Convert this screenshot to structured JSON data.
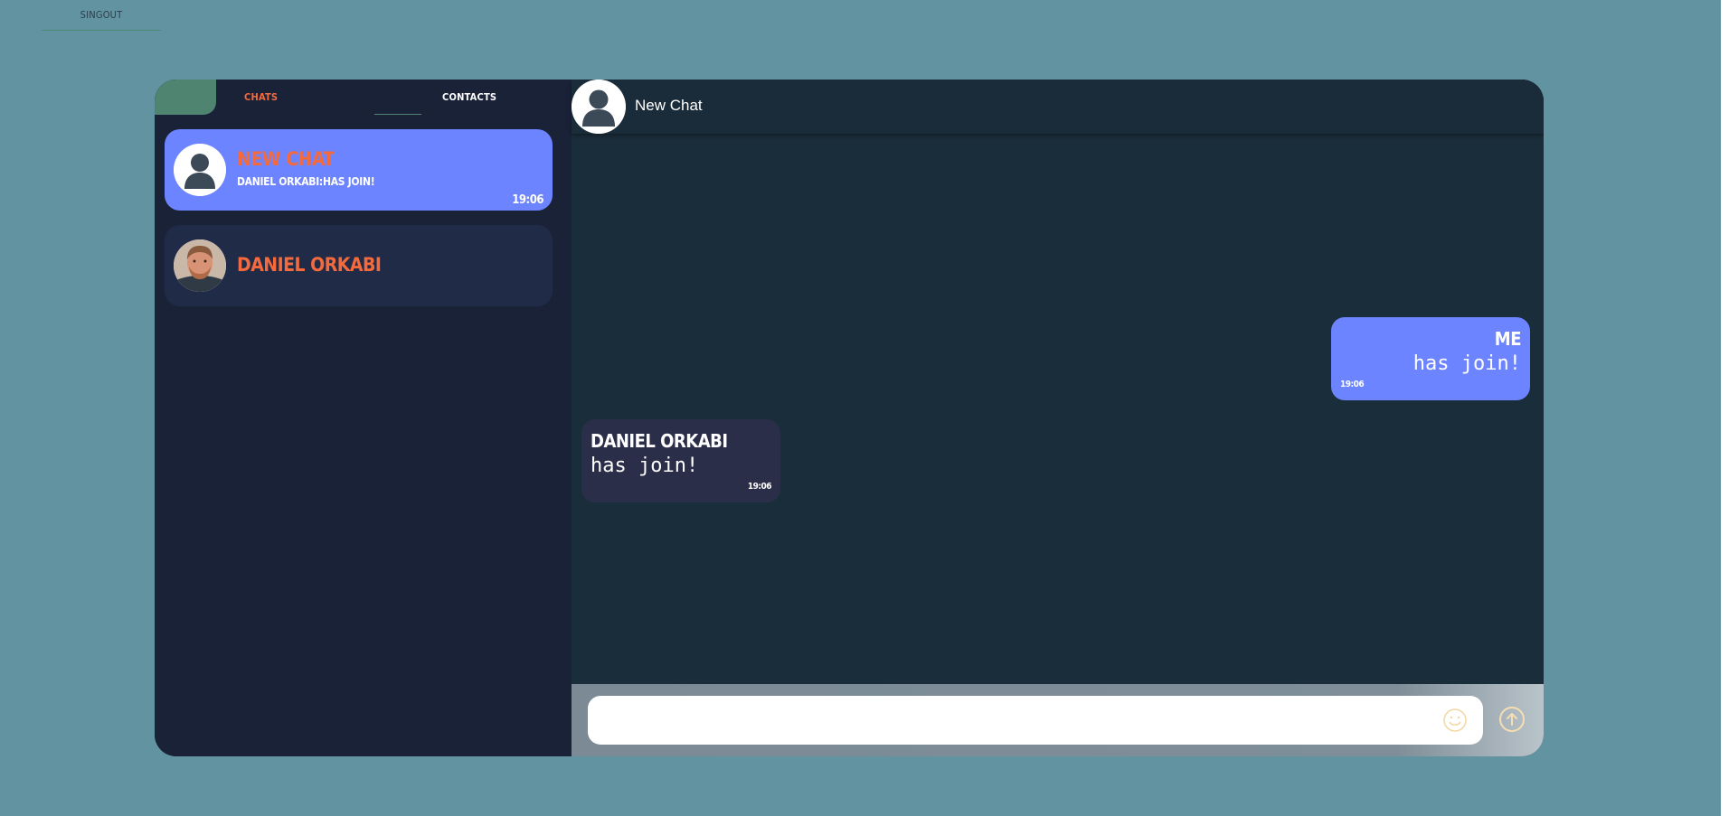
{
  "topbar": {
    "signout_label": "SINGOUT"
  },
  "sidebar": {
    "tabs": [
      {
        "label": "CHATS",
        "active": true
      },
      {
        "label": "CONTACTS",
        "active": false
      }
    ],
    "chats": [
      {
        "name": "NEW CHAT",
        "preview": "DANIEL ORKABI:HAS JOIN!",
        "time": "19:06",
        "active": true,
        "avatar": "default-user-icon"
      },
      {
        "name": "DANIEL ORKABI",
        "preview": "",
        "time": "",
        "active": false,
        "avatar": "user-photo"
      }
    ]
  },
  "conversation": {
    "title": "New Chat",
    "messages": [
      {
        "sender": "ME",
        "text": "has join!",
        "time": "19:06",
        "outgoing": true
      },
      {
        "sender": "DANIEL ORKABI",
        "text": "has join!",
        "time": "19:06",
        "outgoing": false
      }
    ]
  },
  "composer": {
    "placeholder": "",
    "emoji_icon": "smiley-icon",
    "send_icon": "arrow-up-circle-icon"
  },
  "colors": {
    "page_bg": "#6193a0",
    "sidebar_bg": "#1a2238",
    "accent_orange": "#f56a3d",
    "accent_blue": "#6c84ff",
    "tab_indicator": "#4f8470"
  }
}
